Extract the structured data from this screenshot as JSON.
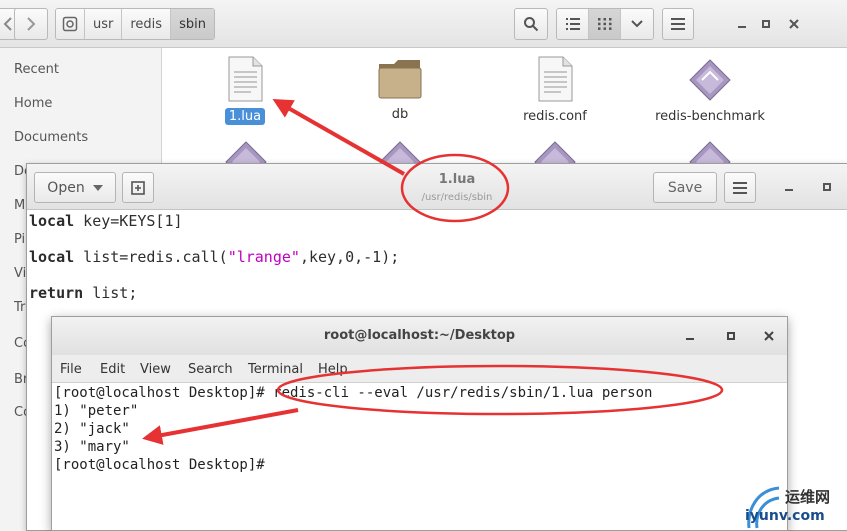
{
  "file_manager": {
    "path": [
      "usr",
      "redis",
      "sbin"
    ],
    "sidebar": [
      {
        "label": "Recent"
      },
      {
        "label": "Home"
      },
      {
        "label": "Documents"
      },
      {
        "label": "De"
      },
      {
        "label": "M"
      },
      {
        "label": "Pi"
      },
      {
        "label": "Vi"
      },
      {
        "label": "Tr"
      },
      {
        "label": "Co"
      },
      {
        "label": "Br"
      },
      {
        "label": "Co"
      }
    ],
    "files": [
      {
        "name": "1.lua",
        "icon": "text-file-icon",
        "selected": true
      },
      {
        "name": "db",
        "icon": "folder-icon",
        "selected": false
      },
      {
        "name": "redis.conf",
        "icon": "text-file-icon",
        "selected": false
      },
      {
        "name": "redis-benchmark",
        "icon": "executable-icon",
        "selected": false
      }
    ]
  },
  "editor": {
    "open_label": "Open",
    "save_label": "Save",
    "title": "1.lua",
    "subtitle": "/usr/redis/sbin",
    "code": [
      {
        "keyword": "local",
        "rest": " key=KEYS[1]"
      },
      {
        "keyword": "local",
        "pre": " list=redis.call(",
        "string": "\"lrange\"",
        "post": ",key,0,-1);"
      },
      {
        "keyword": "return",
        "rest": " list;"
      }
    ]
  },
  "terminal": {
    "title": "root@localhost:~/Desktop",
    "menu": [
      "File",
      "Edit",
      "View",
      "Search",
      "Terminal",
      "Help"
    ],
    "lines": [
      "[root@localhost Desktop]# redis-cli --eval /usr/redis/sbin/1.lua person",
      "1) \"peter\"",
      "2) \"jack\"",
      "3) \"mary\"",
      "[root@localhost Desktop]#"
    ]
  },
  "watermark": {
    "cn": "运维网",
    "url": "iyunv.com"
  },
  "colors": {
    "selection": "#4a90d9",
    "annotation": "#e63232",
    "string": "#c000c0"
  }
}
